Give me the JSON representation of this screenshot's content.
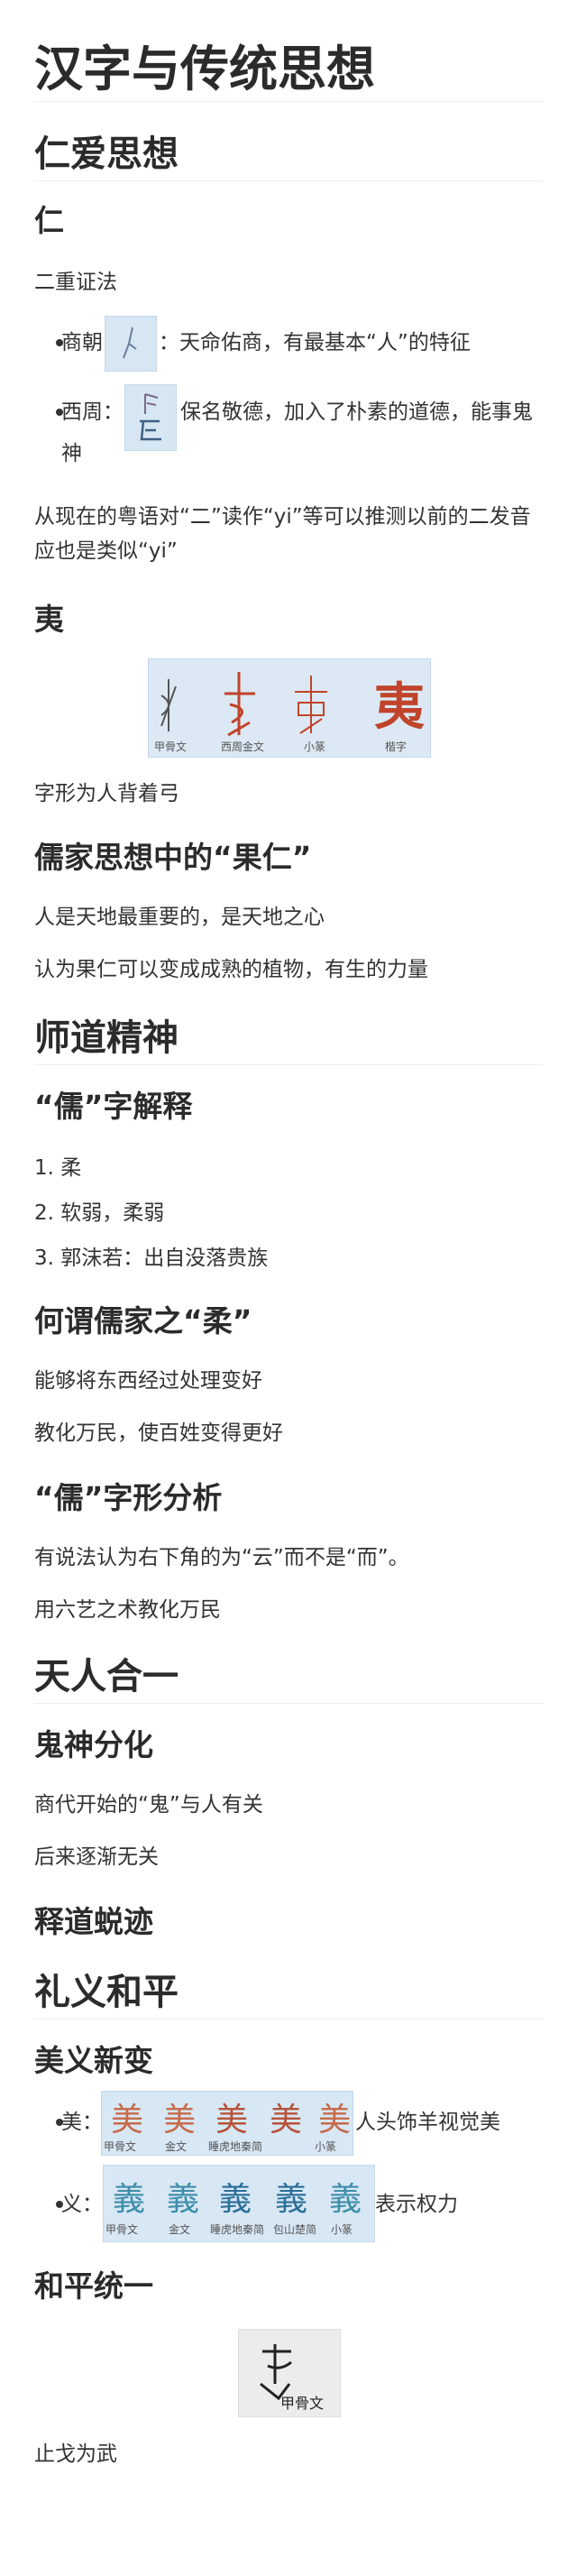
{
  "title": "汉字与传统思想",
  "sections": {
    "renai": "仁爱思想",
    "shidao": "师道精神",
    "tianren": "天人合一",
    "liyi": "礼义和平"
  },
  "ren": {
    "heading": "仁",
    "intro": "二重证法",
    "shang_label": "商朝",
    "shang_text": "：天命佑商，有最基本“人”的特征",
    "xizhou_label": "西周：",
    "xizhou_text": "保名敬德，加入了朴素的道德，能事鬼",
    "xizhou_text2": "神",
    "note": "从现在的粤语对“二”读作“yi”等可以推测以前的二发音应也是类似“yi”"
  },
  "yi": {
    "heading": "夷",
    "captions": [
      "甲骨文",
      "西周金文",
      "小篆",
      "楷字"
    ],
    "glyph": "夷",
    "desc": "字形为人背着弓"
  },
  "guoren": {
    "heading": "儒家思想中的“果仁”",
    "line1": "人是天地最重要的，是天地之心",
    "line2": "认为果仁可以变成成熟的植物，有生的力量"
  },
  "ru": {
    "heading": "“儒”字解释",
    "items": [
      "柔",
      "软弱，柔弱",
      "郭沫若：出自没落贵族"
    ],
    "rou_heading": "何谓儒家之“柔”",
    "rou1": "能够将东西经过处理变好",
    "rou2": "教化万民，使百姓变得更好",
    "shape_heading": "“儒”字形分析",
    "shape1": "有说法认为右下角的为“云”而不是“而”。",
    "shape2": "用六艺之术教化万民"
  },
  "guishen": {
    "heading": "鬼神分化",
    "line1": "商代开始的“鬼”与人有关",
    "line2": "后来逐渐无关"
  },
  "shidao_trace": {
    "heading": "释道蜕迹"
  },
  "meiyi": {
    "heading": "美义新变",
    "mei_label": "美：",
    "mei_text": "人头饰羊视觉美",
    "mei_captions": [
      "甲骨文",
      "金文",
      "睡虎地秦简",
      "小篆"
    ],
    "mei_glyph": "美",
    "yi_label": "义：",
    "yi_text": "表示权力",
    "yi_captions": [
      "甲骨文",
      "金文",
      "睡虎地秦简",
      "包山楚简",
      "小篆"
    ],
    "yi_glyph": "義"
  },
  "heping": {
    "heading": "和平统一",
    "caption": "甲骨文",
    "desc": "止戈为武"
  }
}
